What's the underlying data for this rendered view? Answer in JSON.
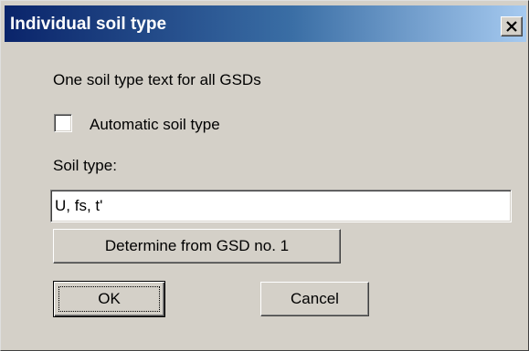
{
  "window": {
    "title": "Individual soil type",
    "close_glyph": "X"
  },
  "dialog": {
    "heading": "One soil type text for all GSDs",
    "automatic_checkbox": {
      "label": "Automatic soil type",
      "checked": false
    },
    "soil_type_label": "Soil type:",
    "soil_type_value": "U, fs, t'",
    "determine_button_label": "Determine from GSD no. 1",
    "ok_button_label": "OK",
    "cancel_button_label": "Cancel"
  },
  "colors": {
    "face": "#d4d0c8",
    "title_start": "#0a246a",
    "title_end": "#a6caf0",
    "field_background": "#ffffff"
  },
  "icons": {
    "close": "close-icon"
  }
}
